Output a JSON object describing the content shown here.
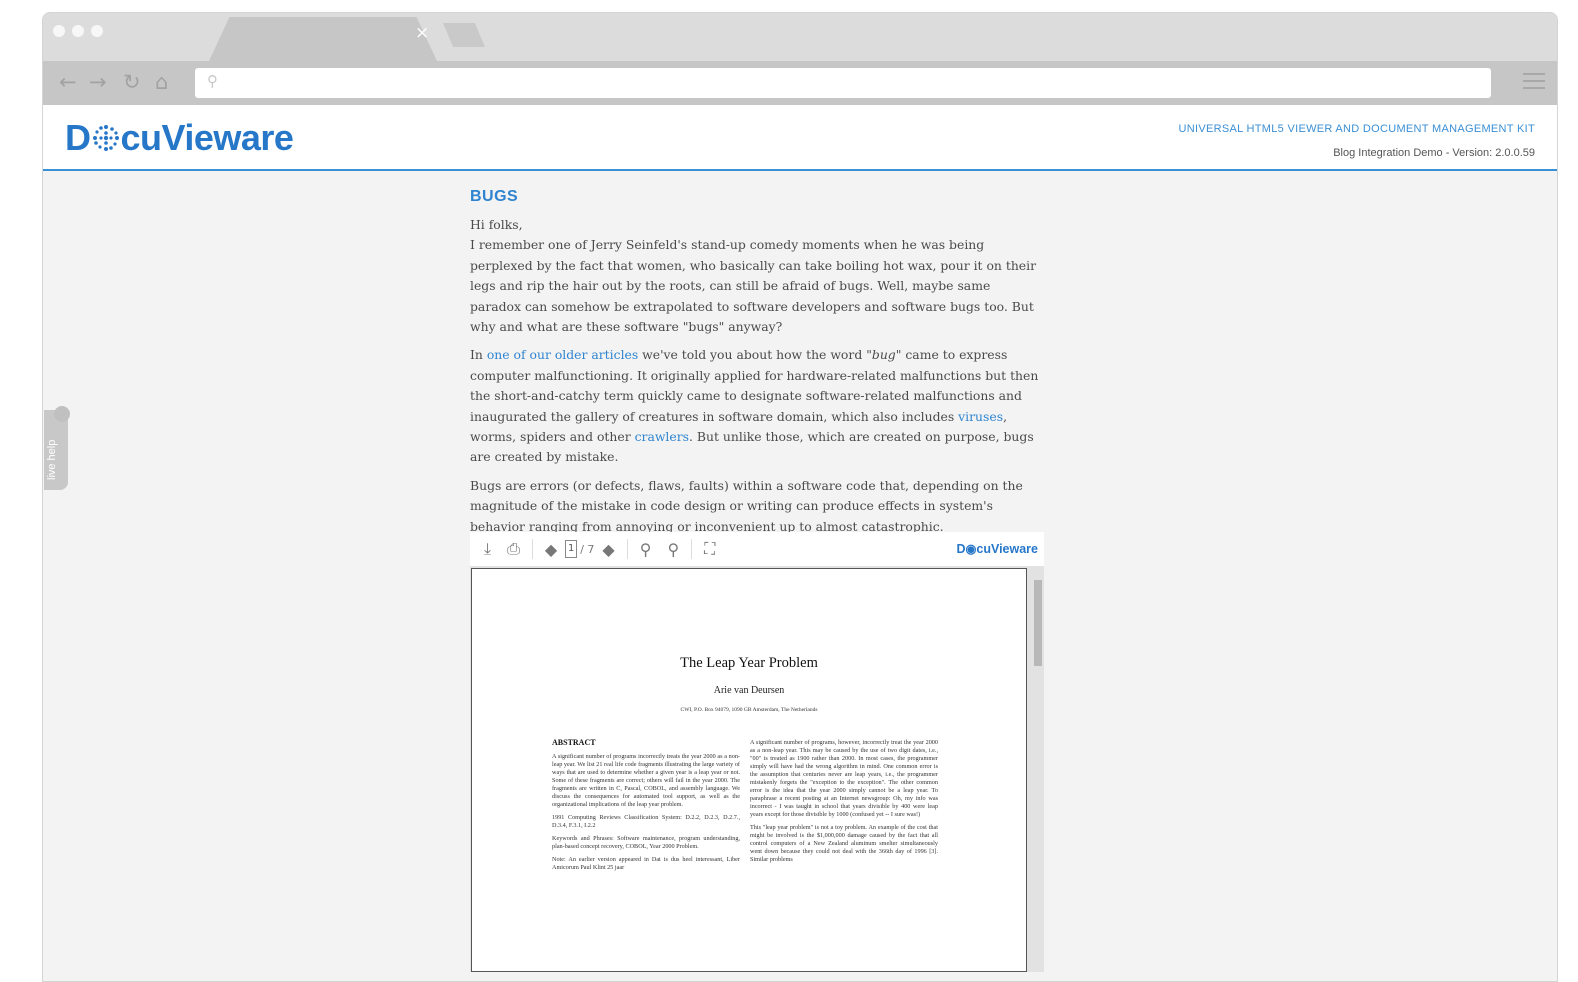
{
  "browser": {
    "tab_close": "×",
    "icons": {
      "back": "arrow-left-icon",
      "forward": "arrow-right-icon",
      "reload": "reload-icon",
      "home": "home-icon",
      "search": "search-icon",
      "menu": "hamburger-menu-icon"
    }
  },
  "header": {
    "logo_pre": "D",
    "logo_post": "cuVieware",
    "kit_title": "UNIVERSAL HTML5 VIEWER AND DOCUMENT MANAGEMENT KIT",
    "version": "Blog Integration Demo - Version: 2.0.0.59",
    "accent_color": "#2777c9"
  },
  "post": {
    "title": "BUGS",
    "greeting": "Hi folks,",
    "p1": "I remember one of Jerry Seinfeld's stand-up comedy moments when he was being perplexed by the fact that women, who basically can take boiling hot wax, pour it on their legs and rip the hair out by the roots, can still be afraid of bugs. Well, maybe same paradox can somehow be extrapolated to software developers and software bugs too. But why and what are these software \"bugs\" anyway?",
    "p2_a": "In ",
    "p2_link1": "one of our older articles",
    "p2_b": " we've told you about how the word \"",
    "p2_em": "bug",
    "p2_c": "\" came to express computer malfunctioning. It originally applied for hardware-related malfunctions but then the short-and-catchy term quickly came to designate software-related malfunctions and inaugurated the gallery of creatures in software domain, which also includes ",
    "p2_link2": "viruses",
    "p2_d": ", worms, spiders and other ",
    "p2_link3": "crawlers",
    "p2_e": ". But unlike those, which are created on purpose, bugs are created by mistake.",
    "p3": "Bugs are errors (or defects, flaws, faults) within a software code that, depending on the magnitude of the mistake in code design or writing can produce effects in system's behavior ranging from annoying or inconvenient up to almost catastrophic."
  },
  "viewer": {
    "page_current": "1",
    "page_total": "/ 7",
    "logo": "D◉cuVieware",
    "icons": [
      "download-icon",
      "print-icon",
      "prev-page-icon",
      "next-page-icon",
      "zoom-in-icon",
      "zoom-out-icon",
      "fullscreen-icon"
    ],
    "document": {
      "title": "The Leap Year Problem",
      "author": "Arie van Deursen",
      "affiliation": "CWI, P.O. Box 94079, 1090 GB Amsterdam, The Netherlands",
      "abstract_heading": "ABSTRACT",
      "abstract": "A significant number of programs incorrectly treats the year 2000 as a non-leap year. We list 21 real life code fragments illustrating the large variety of ways that are used to determine whether a given year is a leap year or not. Some of these fragments are correct; others will fail in the year 2000. The fragments are written in C, Pascal, COBOL, and assembly language. We discuss the consequences for automated tool support, as well as the organizational implications of the leap year problem.",
      "classification": "1991 Computing Reviews Classification System: D.2.2, D.2.3, D.2.7., D.3.4, F.3.1, I.2.2",
      "keywords": "Keywords and Phrases: Software maintenance, program understanding, plan-based concept recovery, COBOL, Year 2000 Problem.",
      "note": "Note: An earlier version appeared in Dat is dus heel interessant, Liber Amicorum Paul Klint 25 jaar",
      "right_col": "A significant number of programs, however, incorrectly treat the year 2000 as a non-leap year. This may be caused by the use of two digit dates, i.e., \"00\" is treated as 1900 rather than 2000. In most cases, the programmer simply will have had the wrong algorithm in mind. One common error is the assumption that centuries never are leap years, i.e., the programmer mistakenly forgets the \"exception to the exception\". The other common error is the idea that the year 2000 simply cannot be a leap year. To paraphrase a recent posting at an Internet newsgroup: Oh, my info was incorrect - I was taught in school that years divisible by 400 were leap years except for those divisible by 1000 (confused yet -- I sure was!)",
      "right_col2": "This \"leap year problem\" is not a toy problem. An example of the cost that might be involved is the $1,000,000 damage caused by the fact that all control computers of a New Zealand aluminum smelter simultaneously went down because they could not deal with the 366th day of 1996 [3]. Similar problems"
    }
  },
  "livehelp": {
    "label": "live help"
  }
}
